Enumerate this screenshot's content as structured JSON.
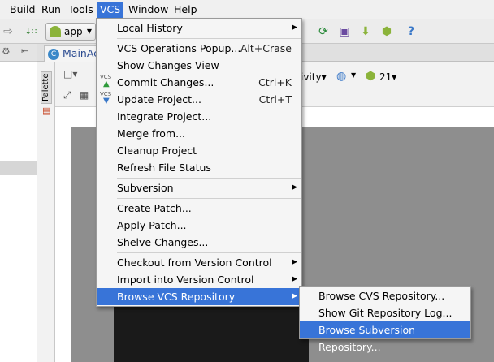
{
  "menubar": {
    "items": [
      "Build",
      "Run",
      "Tools",
      "VCS",
      "Window",
      "Help"
    ],
    "active": "VCS"
  },
  "toolbar": {
    "run_config": "app",
    "icons": [
      "back-arrow-icon",
      "make-icon",
      "sync-icon",
      "avd-manager-icon",
      "sdk-manager-icon",
      "android-device-icon",
      "help-icon"
    ]
  },
  "editor": {
    "tab_label": "MainAct",
    "palette_label": "Palette",
    "activity_label": "ivity",
    "api_level": "21"
  },
  "vcs_menu": {
    "items": [
      {
        "label": "Local History",
        "shortcut": "",
        "submenu": true
      },
      {
        "label": "VCS Operations Popup...",
        "shortcut": "Alt+Crase",
        "submenu": false
      },
      {
        "label": "Show Changes View",
        "shortcut": "",
        "submenu": false
      },
      {
        "label": "Commit Changes...",
        "shortcut": "Ctrl+K",
        "submenu": false
      },
      {
        "label": "Update Project...",
        "shortcut": "Ctrl+T",
        "submenu": false
      },
      {
        "label": "Integrate Project...",
        "shortcut": "",
        "submenu": false
      },
      {
        "label": "Merge from...",
        "shortcut": "",
        "submenu": false
      },
      {
        "label": "Cleanup Project",
        "shortcut": "",
        "submenu": false
      },
      {
        "label": "Refresh File Status",
        "shortcut": "",
        "submenu": false
      },
      {
        "label": "Subversion",
        "shortcut": "",
        "submenu": true
      },
      {
        "label": "Create Patch...",
        "shortcut": "",
        "submenu": false
      },
      {
        "label": "Apply Patch...",
        "shortcut": "",
        "submenu": false
      },
      {
        "label": "Shelve Changes...",
        "shortcut": "",
        "submenu": false
      },
      {
        "label": "Checkout from Version Control",
        "shortcut": "",
        "submenu": true
      },
      {
        "label": "Import into Version Control",
        "shortcut": "",
        "submenu": true
      },
      {
        "label": "Browse VCS Repository",
        "shortcut": "",
        "submenu": true
      }
    ],
    "selected": "Browse VCS Repository",
    "icon_text": "VCS"
  },
  "browse_submenu": {
    "items": [
      "Browse CVS Repository...",
      "Show Git Repository Log...",
      "Browse Subversion Repository..."
    ],
    "selected": "Browse Subversion Repository..."
  },
  "colors": {
    "selection": "#3874d8",
    "menu_bg": "#f5f5f5",
    "canvas_device": "#8e8e8e"
  }
}
